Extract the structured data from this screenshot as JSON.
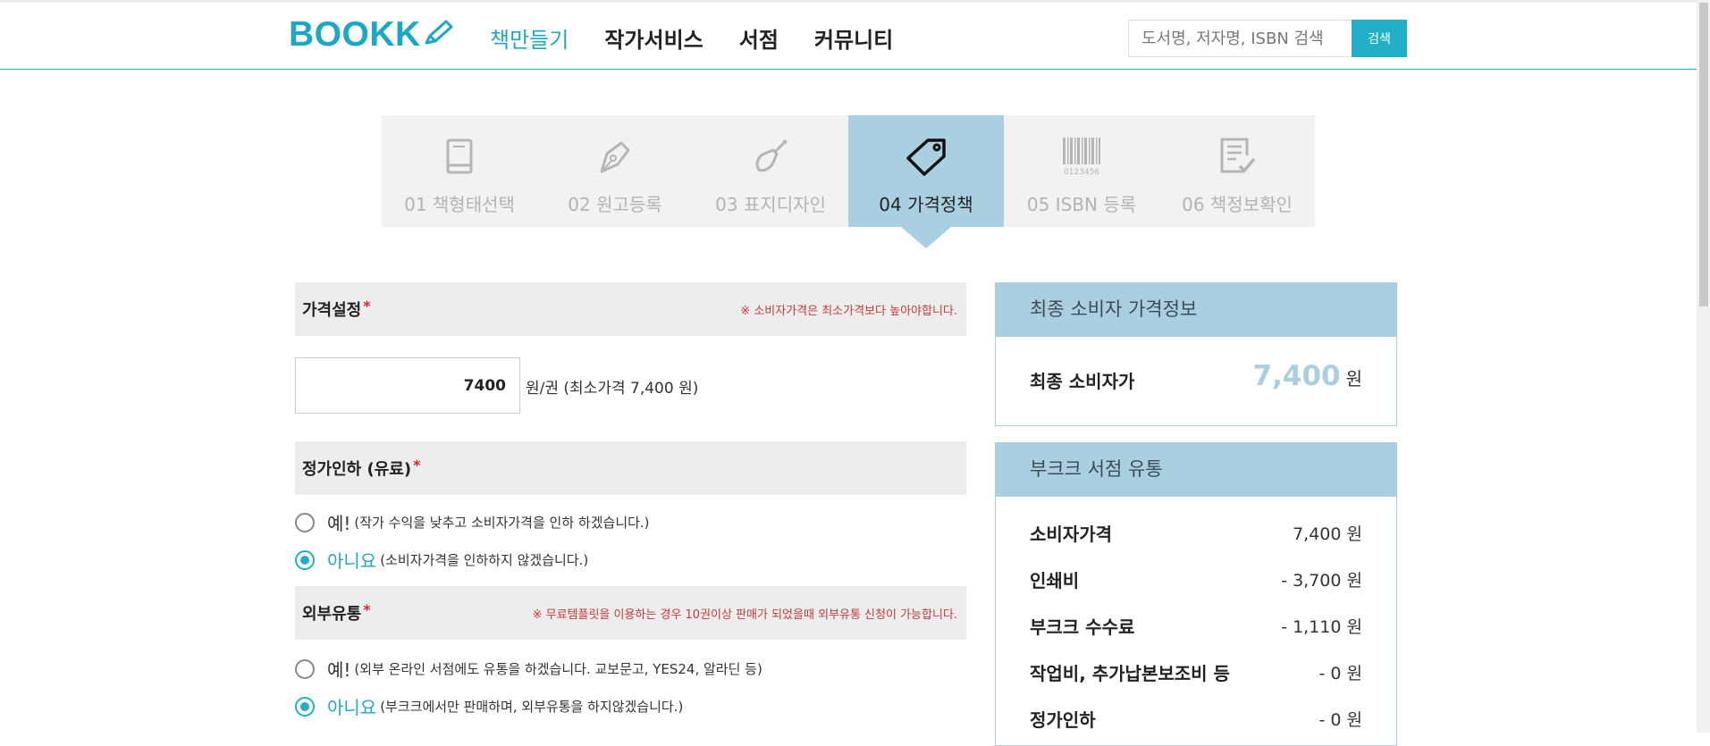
{
  "header": {
    "logo_text": "BOOKK",
    "nav": [
      "책만들기",
      "작가서비스",
      "서점",
      "커뮤니티"
    ],
    "search_placeholder": "도서명, 저자명, ISBN 검색",
    "search_button": "검색",
    "accent_color": "#21b0c8"
  },
  "steps": [
    {
      "label": "01 책형태선택",
      "icon": "book-icon"
    },
    {
      "label": "02 원고등록",
      "icon": "pen-nib-icon"
    },
    {
      "label": "03 표지디자인",
      "icon": "brush-icon"
    },
    {
      "label": "04 가격정책",
      "icon": "price-tag-icon"
    },
    {
      "label": "05 ISBN 등록",
      "icon": "barcode-icon",
      "barcode_number": "0123456"
    },
    {
      "label": "06 책정보확인",
      "icon": "document-check-icon"
    }
  ],
  "active_step": 3,
  "price": {
    "title": "가격설정",
    "required": "*",
    "note": "※ 소비자가격은 최소가격보다 높아야합니다.",
    "value": "7400",
    "unit_text": "원/권 (최소가격 7,400 원)"
  },
  "discount": {
    "title": "정가인하 (유료)",
    "required": "*",
    "yes": {
      "label": "예!",
      "desc": "(작가 수익을 낮추고 소비자가격을 인하 하겠습니다.)"
    },
    "no": {
      "label": "아니요",
      "desc": "(소비자가격을 인하하지 않겠습니다.)"
    },
    "selected": "no"
  },
  "external": {
    "title": "외부유통",
    "required": "*",
    "note": "※ 무료템플릿을 이용하는 경우 10권이상 판매가 되었을때 외부유통 신청이 가능합니다.",
    "yes": {
      "label": "예!",
      "desc": "(외부 온라인 서점에도 유통을 하겠습니다. 교보문고, YES24, 알라딘 등)"
    },
    "no": {
      "label": "아니요",
      "desc": "(부크크에서만 판매하며, 외부유통을 하지않겠습니다.)"
    },
    "selected": "no"
  },
  "final_card": {
    "title": "최종 소비자 가격정보",
    "label": "최종 소비자가",
    "value": "7,400",
    "unit": "원"
  },
  "dist_card": {
    "title": "부크크 서점 유통",
    "rows": [
      {
        "label": "소비자가격",
        "value": "7,400 원"
      },
      {
        "label": "인쇄비",
        "value": "- 3,700 원"
      },
      {
        "label": "부크크 수수료",
        "value": "- 1,110 원"
      },
      {
        "label": "작업비, 추가납본보조비 등",
        "value": "- 0 원"
      },
      {
        "label": "정가인하",
        "value": "- 0 원"
      }
    ]
  }
}
